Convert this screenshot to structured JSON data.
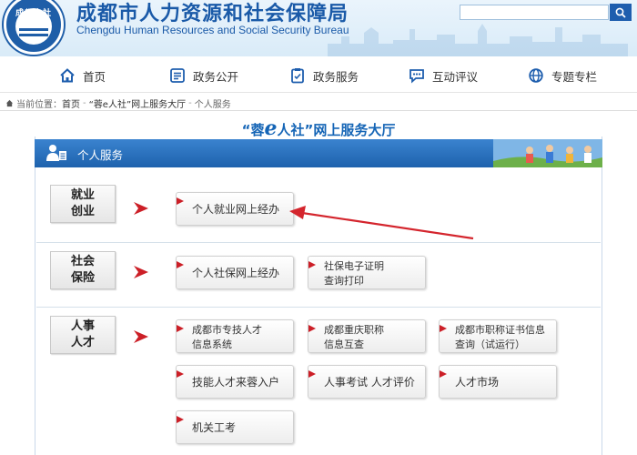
{
  "header": {
    "logo_text": "成都人社",
    "title_cn": "成都市人力资源和社会保障局",
    "title_en": "Chengdu Human Resources and Social Security Bureau",
    "search": {
      "value": "",
      "placeholder": ""
    },
    "brand_color": "#1a5aa8"
  },
  "nav": {
    "items": [
      {
        "label": "首页",
        "icon": "home-icon"
      },
      {
        "label": "政务公开",
        "icon": "list-icon"
      },
      {
        "label": "政务服务",
        "icon": "clipboard-icon"
      },
      {
        "label": "互动评议",
        "icon": "chat-icon"
      },
      {
        "label": "专题专栏",
        "icon": "globe-icon"
      }
    ]
  },
  "breadcrumb": {
    "prefix": "当前位置：",
    "items": [
      "首页",
      "“蓉e人社”网上服务大厅",
      "个人服务"
    ],
    "separator": "-"
  },
  "hall": {
    "title_prefix": "“蓉",
    "title_e": "e",
    "title_suffix": "人社”网上服务大厅",
    "panel_title": "个人服务"
  },
  "categories": [
    {
      "line1": "就业",
      "line2": "创业",
      "services": [
        {
          "label": "个人就业网上经办"
        }
      ]
    },
    {
      "line1": "社会",
      "line2": "保险",
      "services": [
        {
          "label": "个人社保网上经办"
        },
        {
          "line1": "社保电子证明",
          "line2": "查询打印"
        }
      ]
    },
    {
      "line1": "人事",
      "line2": "人才",
      "services": [
        {
          "line1": "成都市专技人才",
          "line2": "信息系统"
        },
        {
          "line1": "成都重庆职称",
          "line2": "信息互查"
        },
        {
          "line1": "成都市职称证书信息",
          "line2": "查询（试运行）"
        },
        {
          "label": "技能人才来蓉入户"
        },
        {
          "label": "人事考试 人才评价"
        },
        {
          "label": "人才市场"
        },
        {
          "label": "机关工考"
        }
      ]
    }
  ],
  "colors": {
    "accent_red": "#cc1f27",
    "panel_blue": "#1e62ad",
    "title_blue": "#1565b6"
  }
}
